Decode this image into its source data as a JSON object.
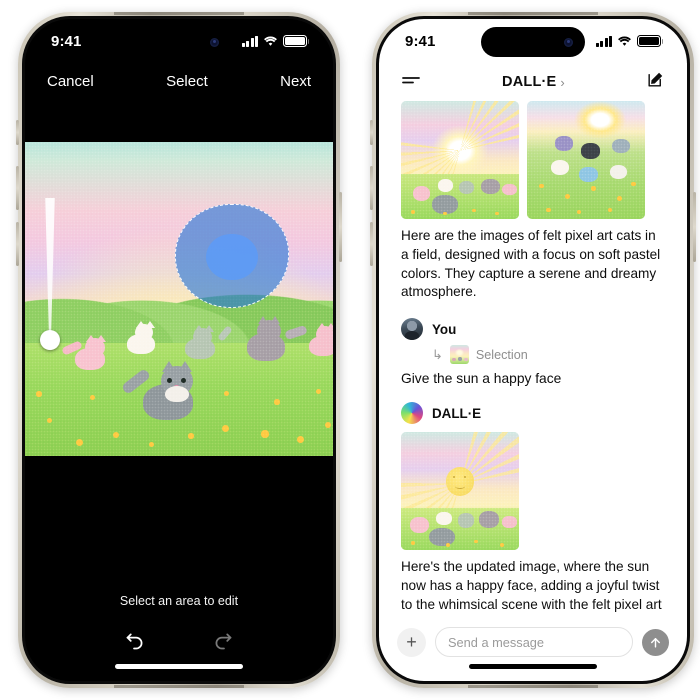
{
  "left_phone": {
    "status_bar": {
      "time": "9:41",
      "icons": [
        "cellular-signal-icon",
        "wifi-icon",
        "battery-icon"
      ]
    },
    "nav": {
      "cancel_label": "Cancel",
      "title": "Select",
      "next_label": "Next"
    },
    "editor": {
      "hint": "Select an area to edit",
      "undo_icon": "undo-icon",
      "redo_icon": "redo-icon",
      "brush_slider_name": "brush-size-slider",
      "selection_name": "selection-mask",
      "selection_color": "#2676d7"
    }
  },
  "right_phone": {
    "status_bar": {
      "time": "9:41",
      "icons": [
        "cellular-signal-icon",
        "wifi-icon",
        "battery-icon"
      ]
    },
    "header": {
      "menu_icon": "sidebar-menu-icon",
      "title": "DALL·E",
      "chevron": "›",
      "compose_icon": "compose-icon"
    },
    "conversation": [
      {
        "role": "assistant",
        "author": "DALL·E",
        "images": 2,
        "text": "Here are the images of felt pixel art cats in a field, designed with a focus on soft pastel colors. They capture a serene and dreamy atmosphere."
      },
      {
        "role": "user",
        "author": "You",
        "attachment_label": "Selection",
        "attachment_arrow": "↳",
        "text": "Give the sun a happy face"
      },
      {
        "role": "assistant",
        "author": "DALL·E",
        "images": 1,
        "text": "Here's the updated image, where the sun now has a happy face, adding a joyful twist to the whimsical scene with the felt pixel art cats."
      }
    ],
    "composer": {
      "add_label": "+",
      "placeholder": "Send a message",
      "send_icon": "arrow-up-icon"
    }
  },
  "colors": {
    "frame": "#cfc9ba",
    "accent_selection": "#2676d7",
    "send_button": "#8e8e8e",
    "muted_text": "#8e8e8e"
  }
}
